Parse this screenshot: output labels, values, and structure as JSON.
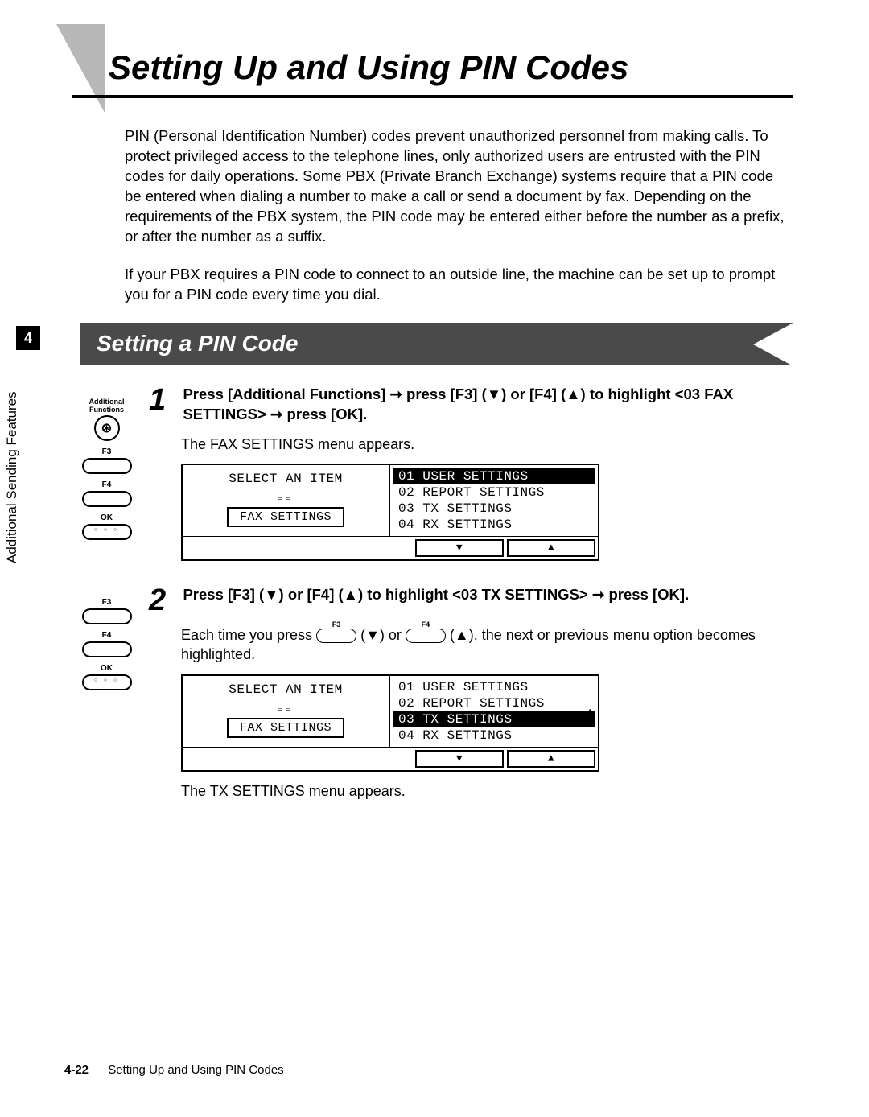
{
  "page": {
    "title": "Setting Up and Using PIN Codes",
    "intro_p1": "PIN (Personal Identification Number) codes prevent unauthorized personnel from making calls. To protect privileged access to the telephone lines, only authorized users are entrusted with the PIN codes for daily operations. Some PBX (Private Branch Exchange) systems require that a PIN code be entered when dialing a number to make a call or send a document by fax. Depending on the requirements of the PBX system, the PIN code may be entered either before the number as a prefix, or after the number as a suffix.",
    "intro_p2": "If your PBX requires a PIN code to connect to an outside line, the machine can be set up to prompt you for a PIN code every time you dial.",
    "section_header": "Setting a PIN Code",
    "chapter_num": "4",
    "side_label": "Additional Sending Features",
    "footer_page": "4-22",
    "footer_title": "Setting Up and Using PIN Codes"
  },
  "buttons": {
    "additional_functions": "Additional Functions",
    "f3": "F3",
    "f4": "F4",
    "ok": "OK"
  },
  "step1": {
    "num": "1",
    "instruction_1": "Press [Additional Functions] ➞ press [F3] (▼) or [F4] (▲) to highlight <03 FAX SETTINGS> ➞ press [OK].",
    "sub": "The FAX SETTINGS menu appears.",
    "lcd": {
      "left_title": "SELECT AN ITEM",
      "left_box": "FAX SETTINGS",
      "items": [
        "01 USER SETTINGS",
        "02 REPORT SETTINGS",
        "03 TX SETTINGS",
        "04 RX SETTINGS"
      ],
      "highlighted_index": 0
    }
  },
  "step2": {
    "num": "2",
    "instruction_1": "Press [F3] (▼) or [F4] (▲) to highlight <03 TX SETTINGS> ➞ press [OK].",
    "sub_prefix": "Each time you press ",
    "sub_mid": " (▼) or ",
    "sub_suffix": " (▲), the next or previous menu option becomes highlighted.",
    "lcd": {
      "left_title": "SELECT AN ITEM",
      "left_box": "FAX SETTINGS",
      "items": [
        "01 USER SETTINGS",
        "02 REPORT SETTINGS",
        "03 TX SETTINGS",
        "04 RX SETTINGS"
      ],
      "highlighted_index": 2
    },
    "result": "The TX SETTINGS menu appears."
  },
  "lcd_arrows": {
    "down": "▼",
    "up": "▲"
  }
}
